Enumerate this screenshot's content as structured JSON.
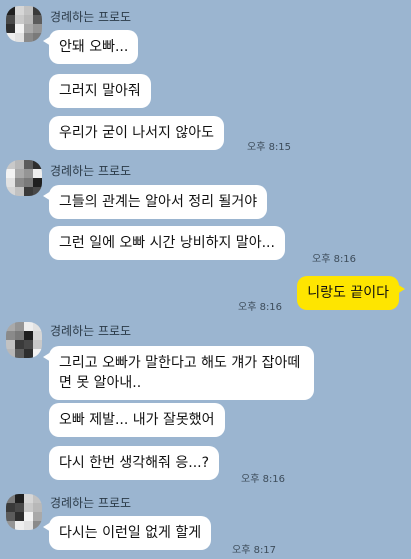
{
  "colors": {
    "background": "#9bb5d0",
    "received_bubble": "#ffffff",
    "sent_bubble": "#fee500"
  },
  "sender_name": "경례하는 프로도",
  "messages": [
    {
      "text": "안돼 오빠..."
    },
    {
      "text": "그러지 말아줘"
    },
    {
      "text": "우리가 굳이 나서지 않아도",
      "time": "오후 8:15"
    },
    {
      "text": "그들의 관계는 알아서 정리 될거야"
    },
    {
      "text": "그런 일에 오빠 시간 낭비하지 말아...",
      "time": "오후 8:16"
    },
    {
      "text": "니랑도 끝이다",
      "time": "오후 8:16"
    },
    {
      "text": "그리고 오빠가 말한다고 해도 걔가 잡아떼면 못 알아내.."
    },
    {
      "text": "오빠 제발... 내가 잘못했어"
    },
    {
      "text": "다시 한번 생각해줘 응...?",
      "time": "오후 8:16"
    },
    {
      "text": "다시는 이런일 없게 할게",
      "time": "오후 8:17"
    }
  ],
  "avatar_icon": "pixelated-avatar-icon"
}
